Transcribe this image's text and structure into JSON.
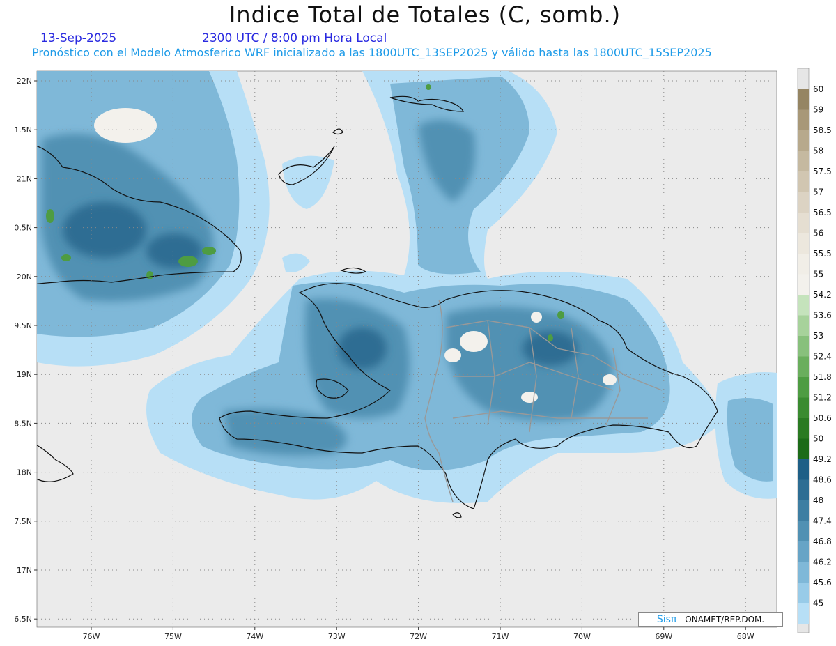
{
  "header": {
    "title": "Indice Total de Totales (C, somb.)",
    "date": "13-Sep-2025",
    "time": "2300 UTC / 8:00 pm Hora Local",
    "subtitle": "Pronóstico con el Modelo Atmosferico WRF inicializado a las 1800UTC_13SEP2025 y válido hasta las  1800UTC_15SEP2025"
  },
  "axes": {
    "lat_labels": [
      "22N",
      "1.5N",
      "21N",
      "0.5N",
      "20N",
      "9.5N",
      "19N",
      "8.5N",
      "18N",
      "7.5N",
      "17N",
      "6.5N"
    ],
    "lon_labels": [
      "76W",
      "75W",
      "74W",
      "73W",
      "72W",
      "71W",
      "70W",
      "69W",
      "68W"
    ]
  },
  "legend": {
    "levels": [
      "60",
      "59",
      "58.5",
      "58",
      "57.5",
      "57",
      "56.5",
      "56",
      "55.5",
      "55",
      "54.2",
      "53.6",
      "53",
      "52.4",
      "51.8",
      "51.2",
      "50.6",
      "50",
      "49.2",
      "48.6",
      "48",
      "47.4",
      "46.8",
      "46.2",
      "45.6",
      "45"
    ],
    "colors": [
      "#958563",
      "#a89878",
      "#b7a98c",
      "#c5b9a0",
      "#d1c6b1",
      "#dcd3c3",
      "#e5ded1",
      "#ece7dd",
      "#f1eee7",
      "#f3f1ec",
      "#c5e3bc",
      "#a7d29b",
      "#88c07c",
      "#6aae5d",
      "#4e9c42",
      "#3a8b30",
      "#2a7a22",
      "#1c6b18",
      "#1e5f86",
      "#2d6d93",
      "#3e7ea2",
      "#5191b3",
      "#67a4c6",
      "#7fb8d8",
      "#98cbe8",
      "#b7dff6"
    ]
  },
  "credit": {
    "brand": "Sisπ",
    "text": "- ONAMET/REP.DOM."
  }
}
